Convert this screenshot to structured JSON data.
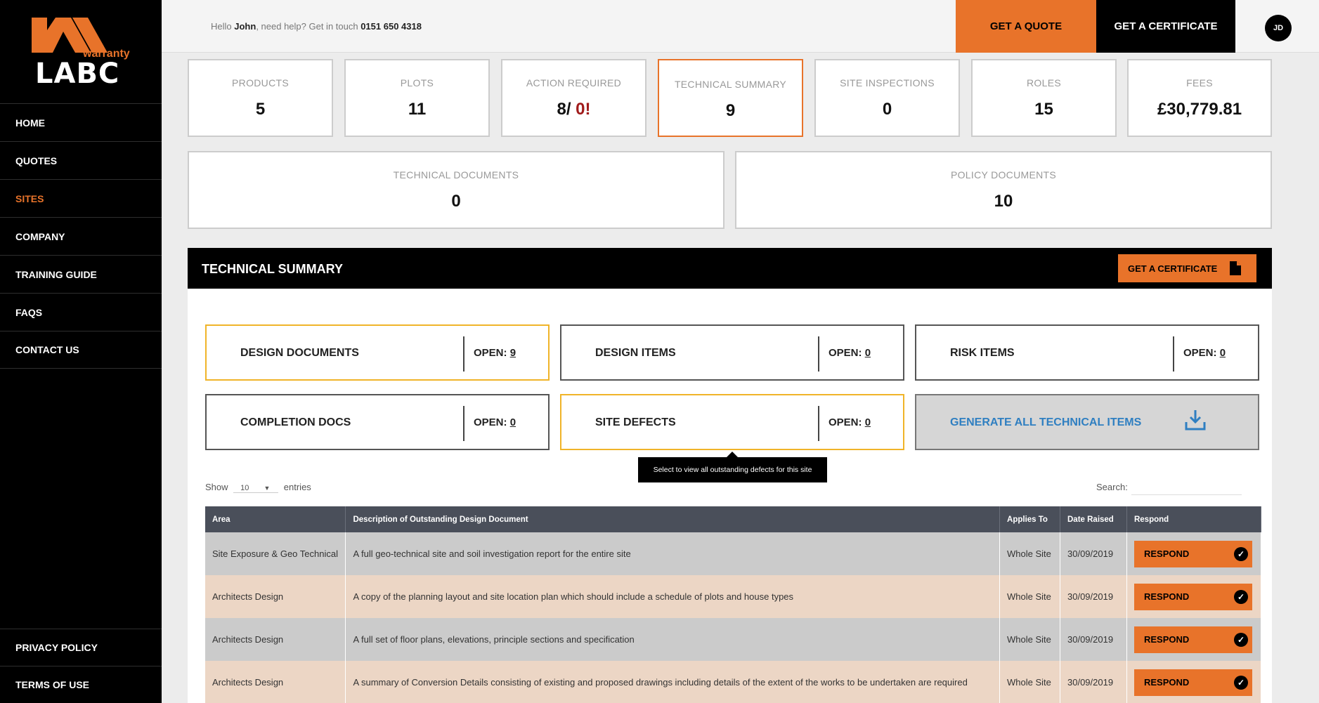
{
  "brand": {
    "logo_small": "warranty",
    "logo_main": "LABC",
    "accent": "#e8732a"
  },
  "nav": {
    "items": [
      {
        "label": "HOME",
        "active": false
      },
      {
        "label": "QUOTES",
        "active": false
      },
      {
        "label": "SITES",
        "active": true
      },
      {
        "label": "COMPANY",
        "active": false
      },
      {
        "label": "TRAINING GUIDE",
        "active": false
      },
      {
        "label": "FAQS",
        "active": false
      },
      {
        "label": "CONTACT US",
        "active": false
      }
    ],
    "bottom": [
      {
        "label": "PRIVACY POLICY"
      },
      {
        "label": "TERMS OF USE"
      }
    ]
  },
  "topbar": {
    "greeting_pre": "Hello ",
    "user_name": "John",
    "greeting_mid": ", need help? Get in touch ",
    "phone": "0151 650 4318",
    "quote_button": "GET A QUOTE",
    "cert_button": "GET A CERTIFICATE",
    "avatar_initials": "JD"
  },
  "stats": [
    {
      "label": "PRODUCTS",
      "value": "5"
    },
    {
      "label": "PLOTS",
      "value": "11"
    },
    {
      "label": "ACTION REQUIRED",
      "value_a": "8/ ",
      "value_b": "0!"
    },
    {
      "label": "TECHNICAL SUMMARY",
      "value": "9"
    },
    {
      "label": "SITE INSPECTIONS",
      "value": "0"
    },
    {
      "label": "ROLES",
      "value": "15"
    },
    {
      "label": "FEES",
      "value": "£30,779.81"
    }
  ],
  "docs": [
    {
      "label": "TECHNICAL DOCUMENTS",
      "value": "0"
    },
    {
      "label": "POLICY DOCUMENTS",
      "value": "10"
    }
  ],
  "tech_summary": {
    "title": "TECHNICAL SUMMARY",
    "cert_button": "GET A CERTIFICATE",
    "tiles": [
      {
        "name": "DESIGN DOCUMENTS",
        "open_label": "OPEN: ",
        "open_count": "9"
      },
      {
        "name": "DESIGN ITEMS",
        "open_label": "OPEN: ",
        "open_count": "0"
      },
      {
        "name": "RISK ITEMS",
        "open_label": "OPEN: ",
        "open_count": "0"
      },
      {
        "name": "COMPLETION DOCS",
        "open_label": "OPEN: ",
        "open_count": "0"
      },
      {
        "name": "SITE DEFECTS",
        "open_label": "OPEN: ",
        "open_count": "0"
      }
    ],
    "generate_label": "GENERATE ALL TECHNICAL ITEMS",
    "tooltip": "Select to view all outstanding defects for this site",
    "show_label": "Show",
    "entries_value": "10",
    "entries_label": "entries",
    "search_label": "Search:"
  },
  "table": {
    "headers": [
      "Area",
      "Description of Outstanding Design Document",
      "Applies To",
      "Date Raised",
      "Respond"
    ],
    "rows": [
      {
        "area": "Site Exposure & Geo Technical",
        "desc": "A full geo-technical site and soil investigation report for the entire site",
        "applies": "Whole Site",
        "date": "30/09/2019",
        "respond": "RESPOND"
      },
      {
        "area": "Architects Design",
        "desc": "A copy of the planning layout and site location plan which should include a schedule of plots and house types",
        "applies": "Whole Site",
        "date": "30/09/2019",
        "respond": "RESPOND"
      },
      {
        "area": "Architects Design",
        "desc": "A full set of floor plans, elevations, principle sections and specification",
        "applies": "Whole Site",
        "date": "30/09/2019",
        "respond": "RESPOND"
      },
      {
        "area": "Architects Design",
        "desc": "A summary of Conversion Details consisting of existing and proposed drawings including details of the extent of the works to be undertaken are required",
        "applies": "Whole Site",
        "date": "30/09/2019",
        "respond": "RESPOND"
      }
    ]
  }
}
